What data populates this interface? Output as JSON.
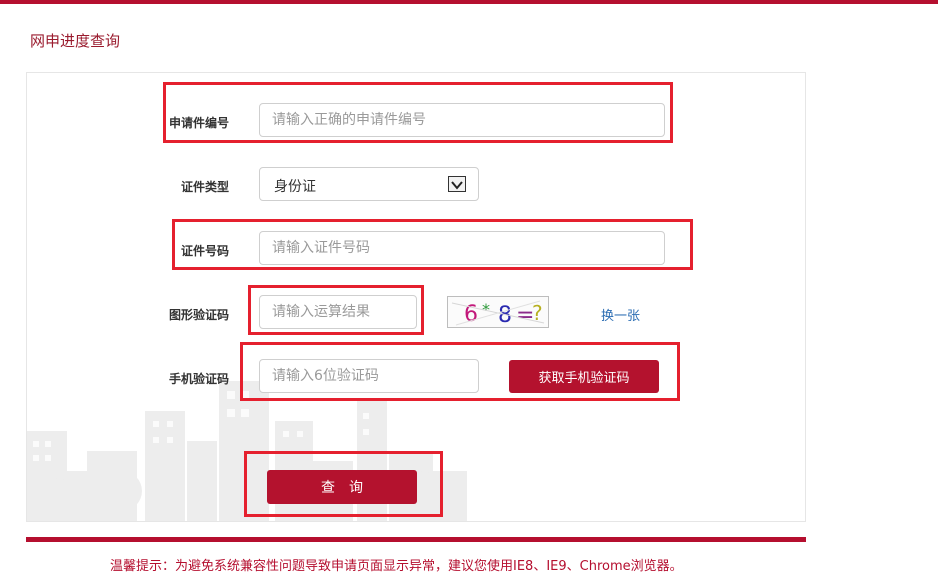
{
  "page": {
    "title": "网申进度查询"
  },
  "form": {
    "application_no": {
      "label": "申请件编号",
      "placeholder": "请输入正确的申请件编号"
    },
    "id_type": {
      "label": "证件类型",
      "selected": "身份证"
    },
    "id_number": {
      "label": "证件号码",
      "placeholder": "请输入证件号码"
    },
    "captcha": {
      "label": "图形验证码",
      "placeholder": "请输入运算结果",
      "image_text": "6*8=?",
      "refresh_label": "换一张"
    },
    "sms_code": {
      "label": "手机验证码",
      "placeholder": "请输入6位验证码",
      "button_label": "获取手机验证码"
    },
    "query_button_label": "查询"
  },
  "footer": {
    "tip": "温馨提示：为避免系统兼容性问题导致申请页面显示异常，建议您使用IE8、IE9、Chrome浏览器。"
  },
  "colors": {
    "brand": "#b50f2f",
    "highlight": "#e5202e",
    "link": "#2b6db3"
  }
}
